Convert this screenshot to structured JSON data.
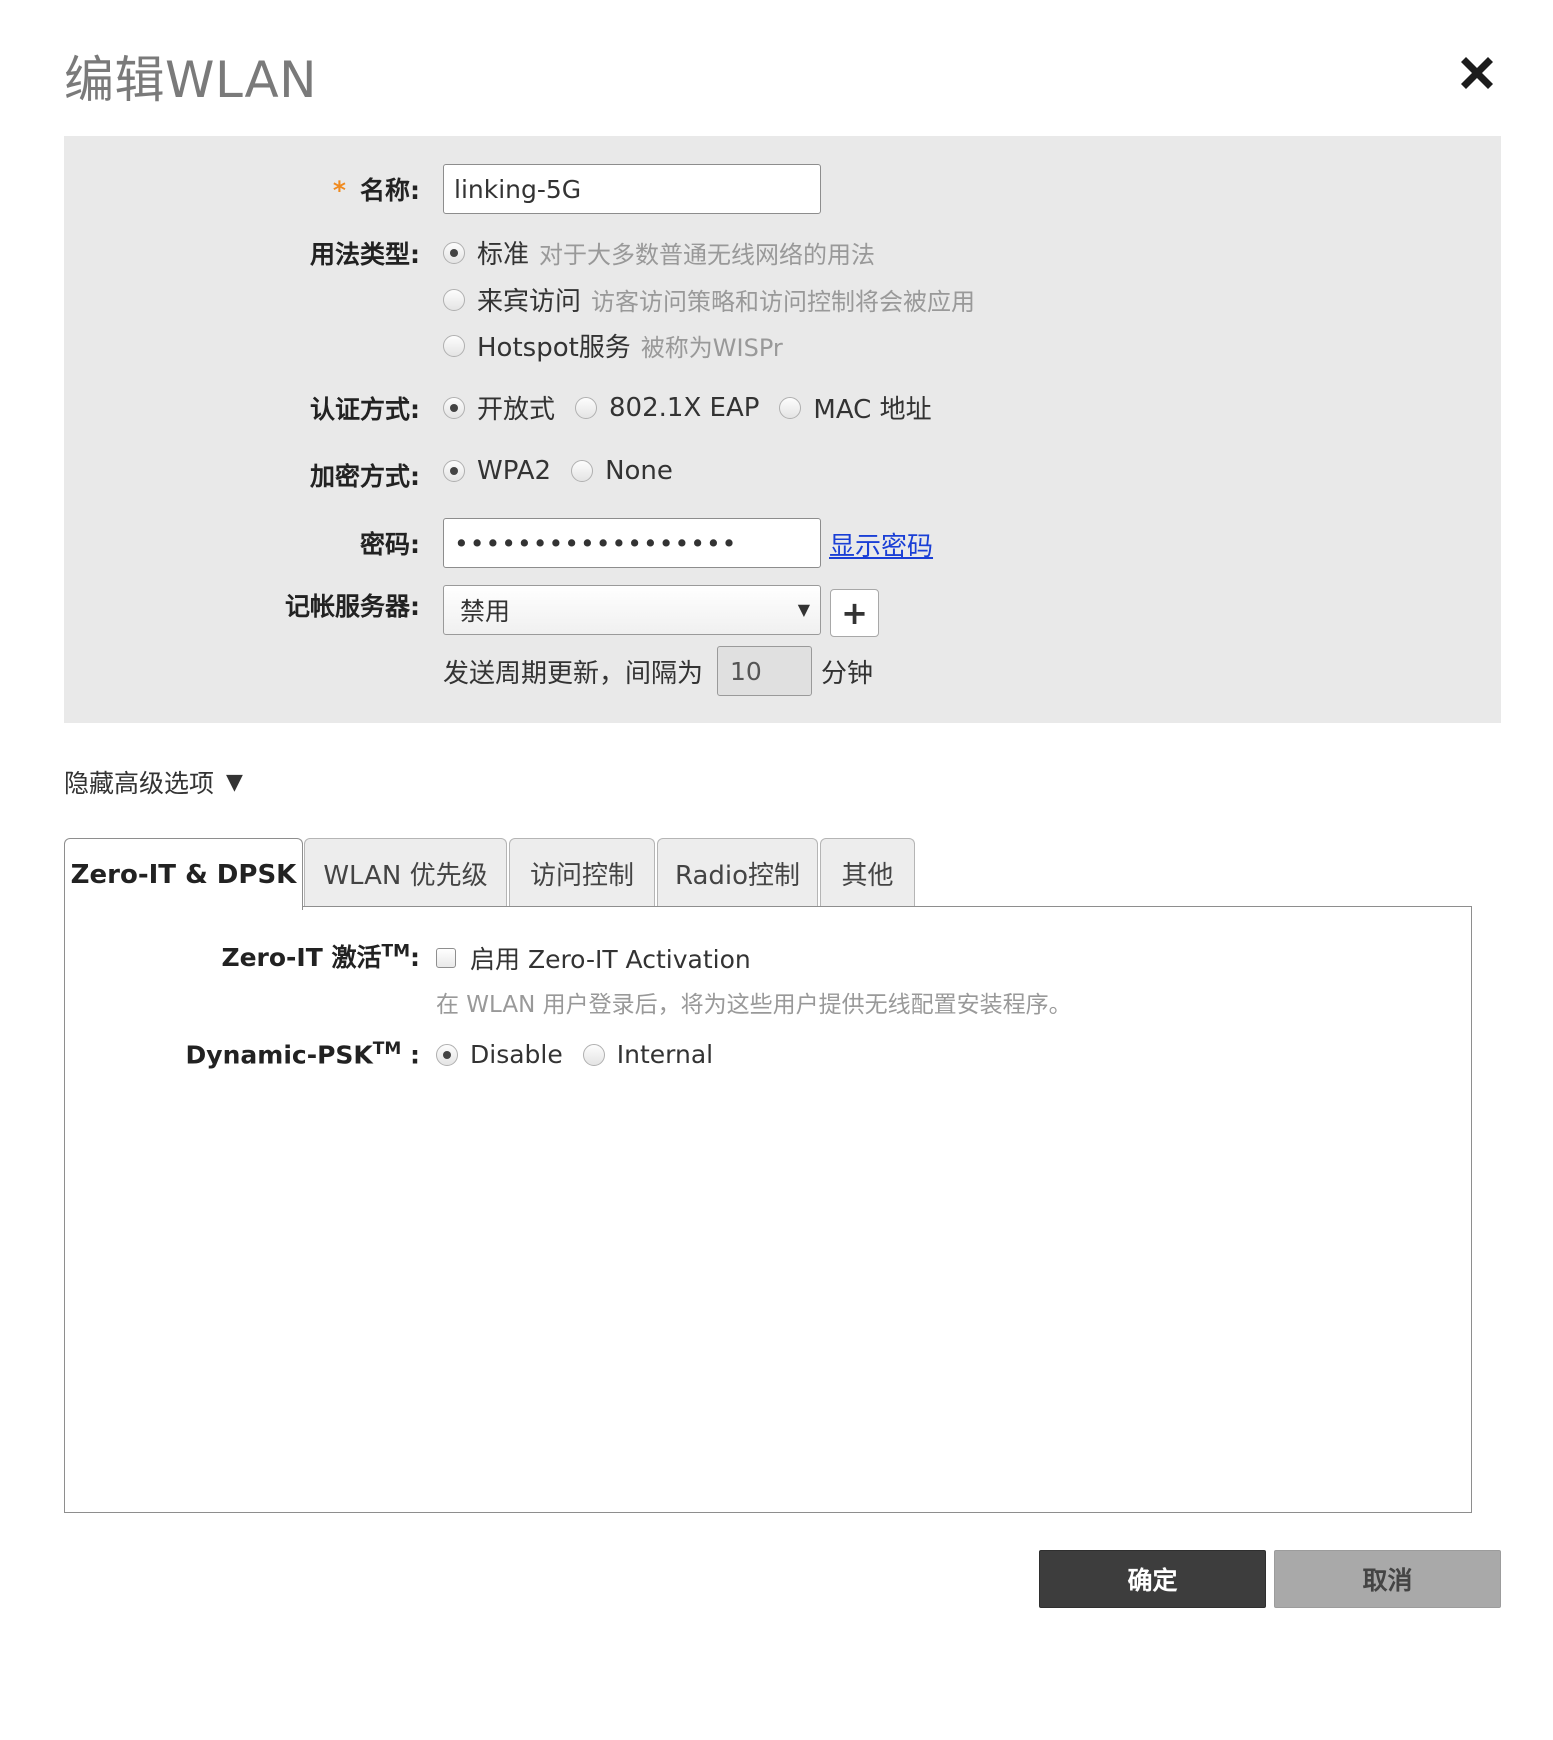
{
  "dialog": {
    "title": "编辑WLAN"
  },
  "form": {
    "name": {
      "required_mark": "*",
      "label": "名称:",
      "value": "linking-5G"
    },
    "usage_type": {
      "label": "用法类型:",
      "options": [
        {
          "label": "标准",
          "hint": "对于大多数普通无线网络的用法",
          "checked": true
        },
        {
          "label": "来宾访问",
          "hint": "访客访问策略和访问控制将会被应用",
          "checked": false
        },
        {
          "label": "Hotspot服务",
          "hint": "被称为WISPr",
          "checked": false
        }
      ]
    },
    "auth_method": {
      "label": "认证方式:",
      "options": [
        {
          "label": "开放式",
          "checked": true
        },
        {
          "label": "802.1X EAP",
          "checked": false
        },
        {
          "label": "MAC 地址",
          "checked": false
        }
      ]
    },
    "encryption": {
      "label": "加密方式:",
      "options": [
        {
          "label": "WPA2",
          "checked": true
        },
        {
          "label": "None",
          "checked": false
        }
      ]
    },
    "password": {
      "label": "密码:",
      "value": "••••••••••••••••••",
      "show_link": "显示密码"
    },
    "accounting_server": {
      "label": "记帐服务器:",
      "selected": "禁用",
      "add_button": "+",
      "interval_prefix": "发送周期更新，间隔为",
      "interval_value": "10",
      "interval_suffix": "分钟"
    }
  },
  "advanced_toggle": {
    "label": "隐藏高级选项",
    "arrow": "▼"
  },
  "tabs": [
    {
      "label": "Zero-IT & DPSK",
      "active": true
    },
    {
      "label": "WLAN 优先级",
      "active": false
    },
    {
      "label": "访问控制",
      "active": false
    },
    {
      "label": "Radio控制",
      "active": false
    },
    {
      "label": "其他",
      "active": false
    }
  ],
  "zero_it": {
    "label": "Zero-IT 激活",
    "label_sup": "TM",
    "label_colon": ":",
    "checkbox_label": "启用 Zero-IT Activation",
    "checkbox_checked": false,
    "hint": "在 WLAN 用户登录后，将为这些用户提供无线配置安装程序。"
  },
  "dpsk": {
    "label": "Dynamic-PSK",
    "label_sup": "TM",
    "label_colon": " :",
    "options": [
      {
        "label": "Disable",
        "checked": true
      },
      {
        "label": "Internal",
        "checked": false
      }
    ]
  },
  "buttons": {
    "ok": "确定",
    "cancel": "取消"
  },
  "colors": {
    "panel_bg": "#e9e9e9",
    "required_star": "#f08a1f",
    "link": "#1a3fd6",
    "ok_button": "#3d3d3d",
    "cancel_button": "#a9a9a9"
  }
}
